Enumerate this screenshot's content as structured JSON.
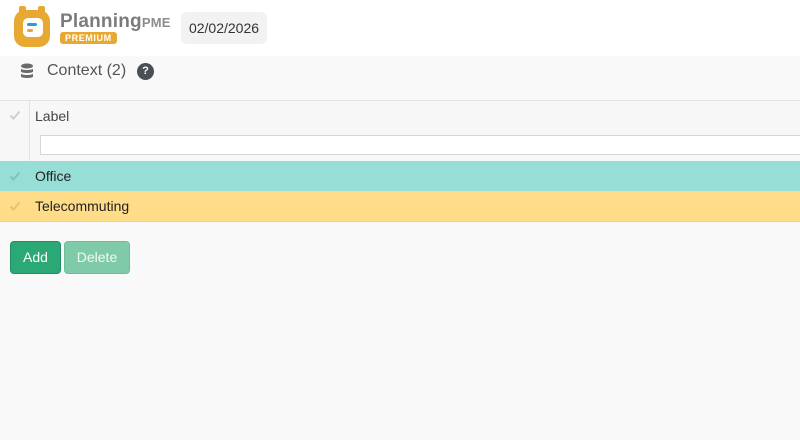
{
  "header": {
    "brand_main": "Planning",
    "brand_suffix": "PME",
    "edition_badge": "PREMIUM",
    "date": "02/02/2026"
  },
  "context": {
    "title": "Context (2)",
    "help_symbol": "?"
  },
  "grid": {
    "columns": [
      {
        "label": "Label"
      }
    ],
    "filter_value": "",
    "rows": [
      {
        "label": "Office",
        "color": "#97ded6"
      },
      {
        "label": "Telecommuting",
        "color": "#ffdc88"
      }
    ]
  },
  "actions": {
    "add_label": "Add",
    "delete_label": "Delete"
  },
  "colors": {
    "accent": "#2aa876",
    "accent_disabled": "#7fcaa9",
    "brand_orange": "#e8a933"
  },
  "icons": {
    "logo": "planningpme-logo-icon",
    "context": "database-icon",
    "help": "help-icon",
    "check": "check-icon"
  }
}
